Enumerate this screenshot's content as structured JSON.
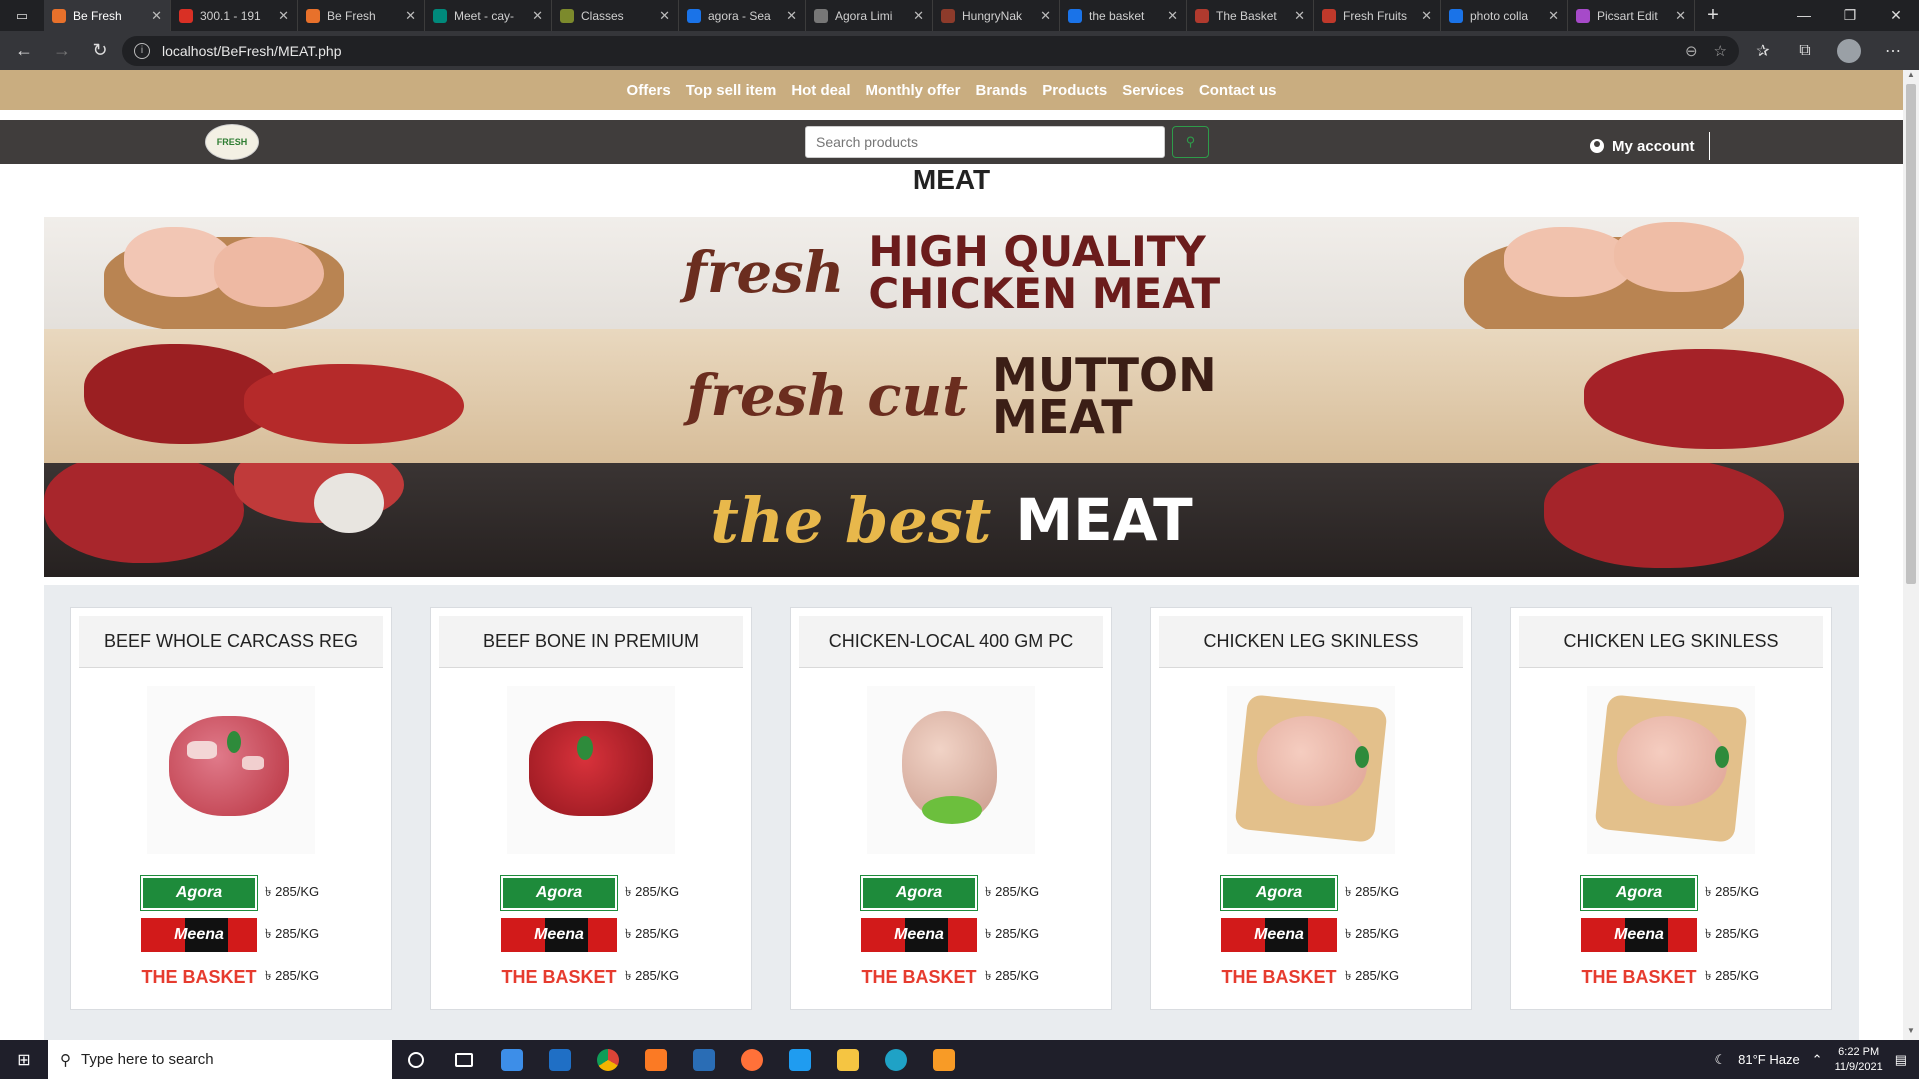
{
  "browser": {
    "tabs": [
      {
        "label": "Be Fresh",
        "active": true,
        "color": "#e8712b"
      },
      {
        "label": "300.1 - 191",
        "active": false,
        "color": "#d93025"
      },
      {
        "label": "Be Fresh",
        "active": false,
        "color": "#e8712b"
      },
      {
        "label": "Meet - cay-",
        "active": false,
        "color": "#00897b"
      },
      {
        "label": "Classes",
        "active": false,
        "color": "#7c8a2c"
      },
      {
        "label": "agora - Sea",
        "active": false,
        "color": "#1a73e8"
      },
      {
        "label": "Agora Limi",
        "active": false,
        "color": "#777777"
      },
      {
        "label": "HungryNak",
        "active": false,
        "color": "#8d3b2b"
      },
      {
        "label": "the basket",
        "active": false,
        "color": "#1a73e8"
      },
      {
        "label": "The Basket",
        "active": false,
        "color": "#b03a2e"
      },
      {
        "label": "Fresh Fruits",
        "active": false,
        "color": "#c0392b"
      },
      {
        "label": "photo colla",
        "active": false,
        "color": "#1a73e8"
      },
      {
        "label": "Picsart Edit",
        "active": false,
        "color": "#a64ac9"
      }
    ],
    "url": "localhost/BeFresh/MEAT.php"
  },
  "site": {
    "nav": [
      "Offers",
      "Top sell item",
      "Hot deal",
      "Monthly offer",
      "Brands",
      "Products",
      "Services",
      "Contact us"
    ],
    "logo_text": "FRESH",
    "search_placeholder": "Search products",
    "account_label": "My account",
    "page_title": "MEAT"
  },
  "banner": {
    "row1": {
      "script": "fresh",
      "bold_line1": "HIGH QUALITY",
      "bold_line2": "CHICKEN MEAT"
    },
    "row2": {
      "script": "fresh cut",
      "bold_line1": "MUTTON",
      "bold_line2": "MEAT"
    },
    "row3": {
      "script": "the best",
      "bold": "MEAT"
    }
  },
  "stores": [
    {
      "name": "Agora",
      "class": "agora"
    },
    {
      "name": "Meena",
      "class": "meena"
    },
    {
      "name": "THE BASKET",
      "class": "basket"
    }
  ],
  "products": [
    {
      "title": "BEEF WHOLE CARCASS REG",
      "image": "beef-cubes",
      "prices": [
        "৳ 285/KG",
        "৳ 285/KG",
        "৳ 285/KG"
      ]
    },
    {
      "title": "BEEF BONE IN PREMIUM",
      "image": "beef-bone",
      "prices": [
        "৳ 285/KG",
        "৳ 285/KG",
        "৳ 285/KG"
      ]
    },
    {
      "title": "CHICKEN-LOCAL 400 GM PC",
      "image": "whole-chicken",
      "prices": [
        "৳ 285/KG",
        "৳ 285/KG",
        "৳ 285/KG"
      ]
    },
    {
      "title": "CHICKEN LEG SKINLESS",
      "image": "chicken-leg",
      "prices": [
        "৳ 285/KG",
        "৳ 285/KG",
        "৳ 285/KG"
      ]
    },
    {
      "title": "CHICKEN LEG SKINLESS",
      "image": "chicken-leg",
      "prices": [
        "৳ 285/KG",
        "৳ 285/KG",
        "৳ 285/KG"
      ]
    }
  ],
  "taskbar": {
    "search_placeholder": "Type here to search",
    "weather": "81°F  Haze",
    "time": "6:22 PM",
    "date": "11/9/2021"
  }
}
